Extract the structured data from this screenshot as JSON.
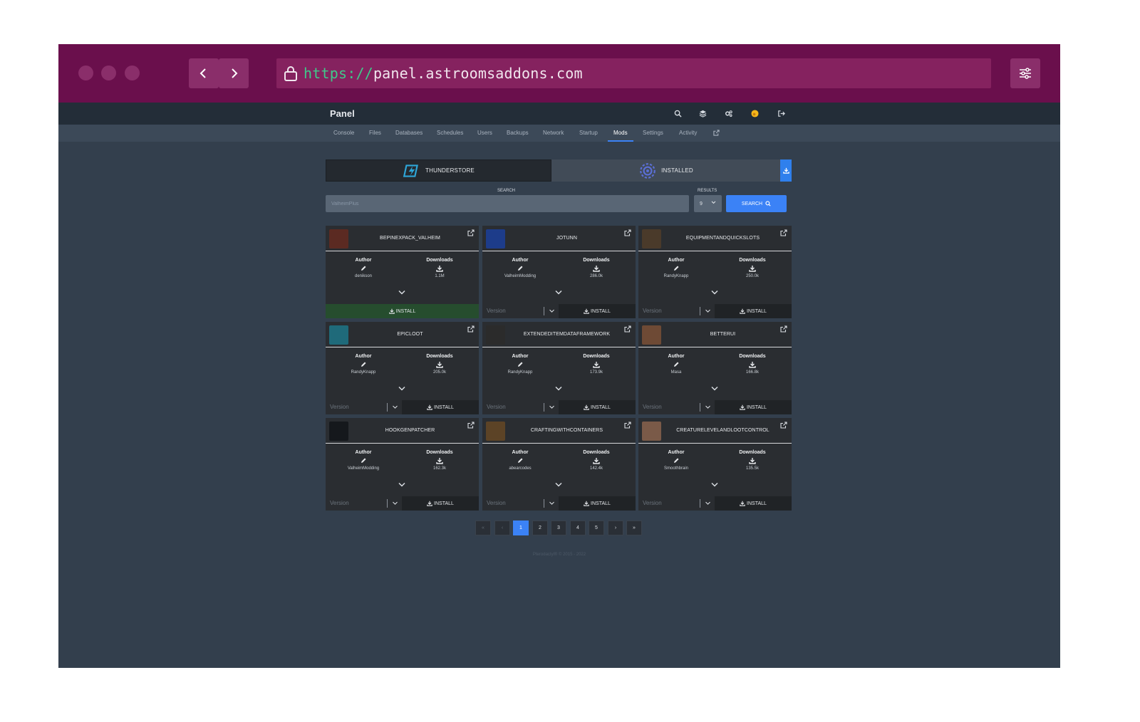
{
  "browser": {
    "url_scheme": "https://",
    "url_host": "panel.astroomsaddons.com"
  },
  "panel": {
    "title": "Panel",
    "top_icons": [
      "search-icon",
      "layers-icon",
      "cogs-icon",
      "avatar",
      "logout-icon"
    ],
    "nav": [
      "Console",
      "Files",
      "Databases",
      "Schedules",
      "Users",
      "Backups",
      "Network",
      "Startup",
      "Mods",
      "Settings",
      "Activity"
    ],
    "active_nav": "Mods"
  },
  "tabs": {
    "thunderstore": "THUNDERSTORE",
    "installed": "INSTALLED"
  },
  "search": {
    "label": "SEARCH",
    "placeholder": "ValheimPlus",
    "results_label": "RESULTS",
    "results_value": "9",
    "button": "SEARCH"
  },
  "cards": [
    {
      "title": "BEPINEXPACK_VALHEIM",
      "author_label": "Author",
      "author": "denikson",
      "downloads_label": "Downloads",
      "downloads": "1.1M",
      "version_placeholder": "",
      "install": "INSTALL",
      "full_install": true,
      "thumb_color": "#5b2a22"
    },
    {
      "title": "JOTUNN",
      "author_label": "Author",
      "author": "ValheimModding",
      "downloads_label": "Downloads",
      "downloads": "286.0k",
      "version_placeholder": "Version",
      "install": "INSTALL",
      "full_install": false,
      "thumb_color": "#1d3c8a"
    },
    {
      "title": "EQUIPMENTANDQUICKSLOTS",
      "author_label": "Author",
      "author": "RandyKnapp",
      "downloads_label": "Downloads",
      "downloads": "250.0k",
      "version_placeholder": "Version",
      "install": "INSTALL",
      "full_install": false,
      "thumb_color": "#4a3a2a"
    },
    {
      "title": "EPICLOOT",
      "author_label": "Author",
      "author": "RandyKnapp",
      "downloads_label": "Downloads",
      "downloads": "205.0k",
      "version_placeholder": "Version",
      "install": "INSTALL",
      "full_install": false,
      "thumb_color": "#1f6a7a"
    },
    {
      "title": "EXTENDEDITEMDATAFRAMEWORK",
      "author_label": "Author",
      "author": "RandyKnapp",
      "downloads_label": "Downloads",
      "downloads": "173.9k",
      "version_placeholder": "Version",
      "install": "INSTALL",
      "full_install": false,
      "thumb_color": "#2b2b2b"
    },
    {
      "title": "BETTERUI",
      "author_label": "Author",
      "author": "Masa",
      "downloads_label": "Downloads",
      "downloads": "166.8k",
      "version_placeholder": "Version",
      "install": "INSTALL",
      "full_install": false,
      "thumb_color": "#6e4a35"
    },
    {
      "title": "HOOKGENPATCHER",
      "author_label": "Author",
      "author": "ValheimModding",
      "downloads_label": "Downloads",
      "downloads": "162.3k",
      "version_placeholder": "Version",
      "install": "INSTALL",
      "full_install": false,
      "thumb_color": "#15181c"
    },
    {
      "title": "CRAFTINGWITHCONTAINERS",
      "author_label": "Author",
      "author": "abearcodes",
      "downloads_label": "Downloads",
      "downloads": "142.4k",
      "version_placeholder": "Version",
      "install": "INSTALL",
      "full_install": false,
      "thumb_color": "#5c4326"
    },
    {
      "title": "CREATURELEVELANDLOOTCONTROL",
      "author_label": "Author",
      "author": "Smoothbrain",
      "downloads_label": "Downloads",
      "downloads": "135.5k",
      "version_placeholder": "Version",
      "install": "INSTALL",
      "full_install": false,
      "thumb_color": "#7a5a48"
    }
  ],
  "pagination": {
    "first": "«",
    "prev": "‹",
    "pages": [
      "1",
      "2",
      "3",
      "4",
      "5"
    ],
    "active": "1",
    "next": "›",
    "last": "»"
  },
  "footer": "Pterodactyl® © 2015 - 2022",
  "colors": {
    "browser_bar": "#6a0f4c",
    "panel_bg": "#333f4d",
    "accent": "#3b82f6",
    "install_green": "#264d2e"
  }
}
